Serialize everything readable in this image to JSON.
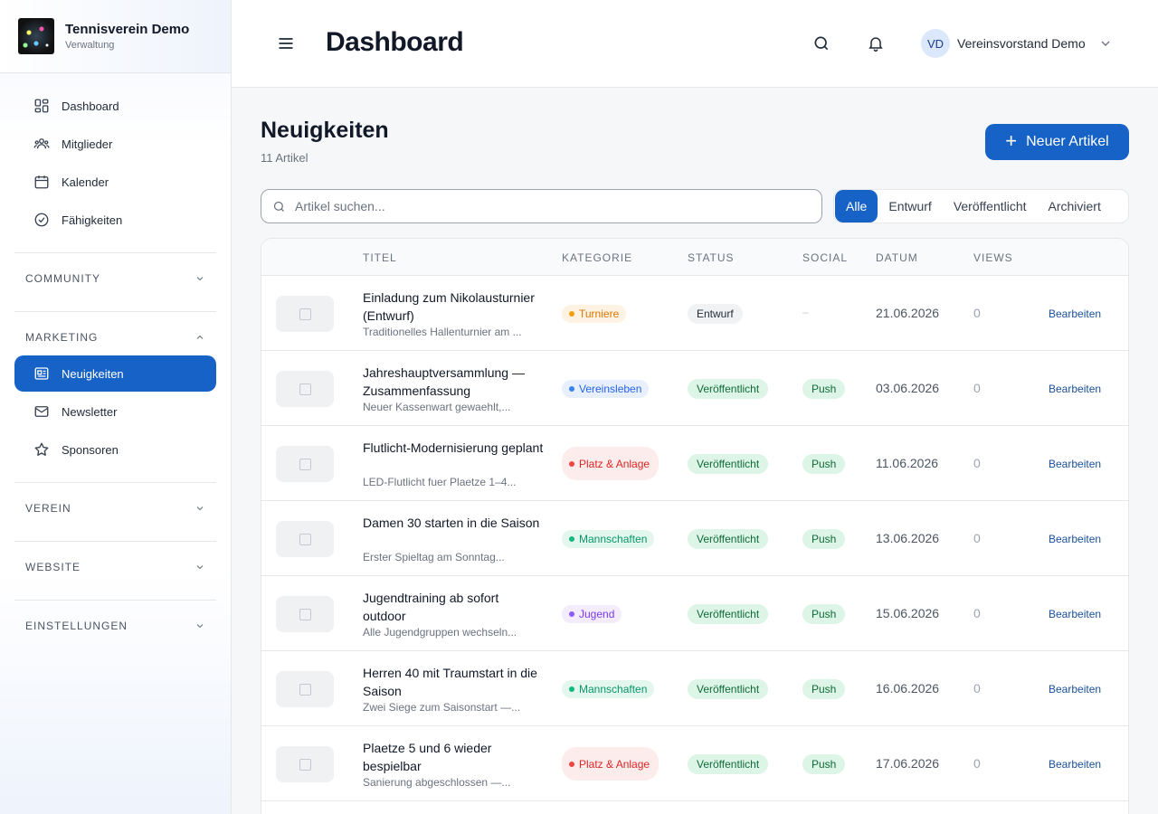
{
  "brand": {
    "name": "Tennisverein Demo",
    "subtitle": "Verwaltung"
  },
  "sidebar": {
    "items": [
      {
        "label": "Dashboard",
        "icon": "dashboard-icon"
      },
      {
        "label": "Mitglieder",
        "icon": "users-icon"
      },
      {
        "label": "Kalender",
        "icon": "calendar-icon"
      },
      {
        "label": "Fähigkeiten",
        "icon": "badge-check-icon"
      }
    ],
    "sections": {
      "community": "COMMUNITY",
      "marketing": "MARKETING",
      "verein": "VEREIN",
      "website": "WEBSITE",
      "einstellungen": "EINSTELLUNGEN"
    },
    "marketing_items": [
      {
        "label": "Neuigkeiten",
        "icon": "newspaper-icon",
        "active": true
      },
      {
        "label": "Newsletter",
        "icon": "mail-icon"
      },
      {
        "label": "Sponsoren",
        "icon": "star-icon"
      }
    ]
  },
  "header": {
    "title": "Dashboard",
    "user_initials": "VD",
    "user_name": "Vereinsvorstand Demo"
  },
  "main": {
    "title": "Neuigkeiten",
    "count": "11 Artikel",
    "new_button": "Neuer Artikel",
    "search_placeholder": "Artikel suchen...",
    "filters": [
      "Alle",
      "Entwurf",
      "Veröffentlicht",
      "Archiviert"
    ],
    "active_filter": "Alle"
  },
  "table": {
    "columns": [
      "TITEL",
      "KATEGORIE",
      "STATUS",
      "SOCIAL",
      "DATUM",
      "VIEWS"
    ],
    "action_label": "Bearbeiten",
    "rows": [
      {
        "title": "Einladung zum Nikolausturnier (Entwurf)",
        "excerpt": "Traditionelles Hallenturnier am ...",
        "category": "Turniere",
        "status": "Entwurf",
        "social": "–",
        "date": "21.06.2026",
        "views": "0"
      },
      {
        "title": "Jahreshauptversammlung — Zusammenfassung",
        "excerpt": "Neuer Kassenwart gewaehlt,...",
        "category": "Vereinsleben",
        "status": "Veröffentlicht",
        "social": "Push",
        "date": "03.06.2026",
        "views": "0"
      },
      {
        "title": "Flutlicht-Modernisierung geplant",
        "excerpt": "LED-Flutlicht fuer Plaetze 1–4...",
        "category": "Platz & Anlage",
        "status": "Veröffentlicht",
        "social": "Push",
        "date": "11.06.2026",
        "views": "0"
      },
      {
        "title": "Damen 30 starten in die Saison",
        "excerpt": "Erster Spieltag am Sonntag...",
        "category": "Mannschaften",
        "status": "Veröffentlicht",
        "social": "Push",
        "date": "13.06.2026",
        "views": "0"
      },
      {
        "title": "Jugendtraining ab sofort outdoor",
        "excerpt": "Alle Jugendgruppen wechseln...",
        "category": "Jugend",
        "status": "Veröffentlicht",
        "social": "Push",
        "date": "15.06.2026",
        "views": "0"
      },
      {
        "title": "Herren 40 mit Traumstart in die Saison",
        "excerpt": "Zwei Siege zum Saisonstart —...",
        "category": "Mannschaften",
        "status": "Veröffentlicht",
        "social": "Push",
        "date": "16.06.2026",
        "views": "0"
      },
      {
        "title": "Plaetze 5 und 6 wieder bespielbar",
        "excerpt": "Sanierung abgeschlossen —...",
        "category": "Platz & Anlage",
        "status": "Veröffentlicht",
        "social": "Push",
        "date": "17.06.2026",
        "views": "0"
      }
    ]
  },
  "colors": {
    "accent": "#1762c6",
    "category_turniere": "#d97706",
    "category_vereinsleben": "#2563eb",
    "category_platz": "#dc2626",
    "category_mannschaften": "#059669",
    "category_jugend": "#7c3aed"
  }
}
